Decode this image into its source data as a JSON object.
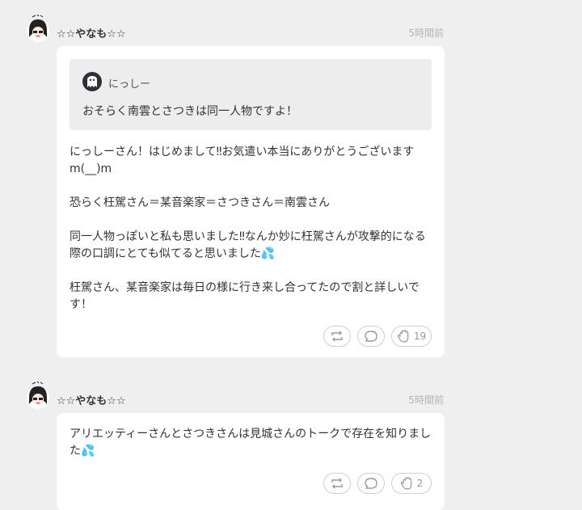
{
  "posts": [
    {
      "username": "☆☆やなも☆☆",
      "time": "5時間前",
      "quote": {
        "username": "にっしー",
        "text": "おそらく南雲とさつきは同一人物ですよ！"
      },
      "paragraphs": [
        "にっしーさん！はじめまして‼お気遣い本当にありがとうございますm(__)m",
        "恐らく枉駕さん＝某音楽家＝さつきさん＝南雲さん",
        "同一人物っぽいと私も思いました‼なんか妙に枉駕さんが攻撃的になる際の口調にとても似てると思いました💦",
        "枉駕さん、某音楽家は毎日の様に行き来し合ってたので割と詳しいです！"
      ],
      "actions": {
        "repost_icon": "repost-icon",
        "reply_icon": "reply-icon",
        "clap_icon": "clap-icon",
        "clap_count": "19"
      }
    },
    {
      "username": "☆☆やなも☆☆",
      "time": "5時間前",
      "paragraphs": [
        "アリエッティーさんとさつきさんは見城さんのトークで存在を知りました💦"
      ],
      "actions": {
        "repost_icon": "repost-icon",
        "reply_icon": "reply-icon",
        "clap_icon": "clap-icon",
        "clap_count": "2"
      }
    }
  ]
}
